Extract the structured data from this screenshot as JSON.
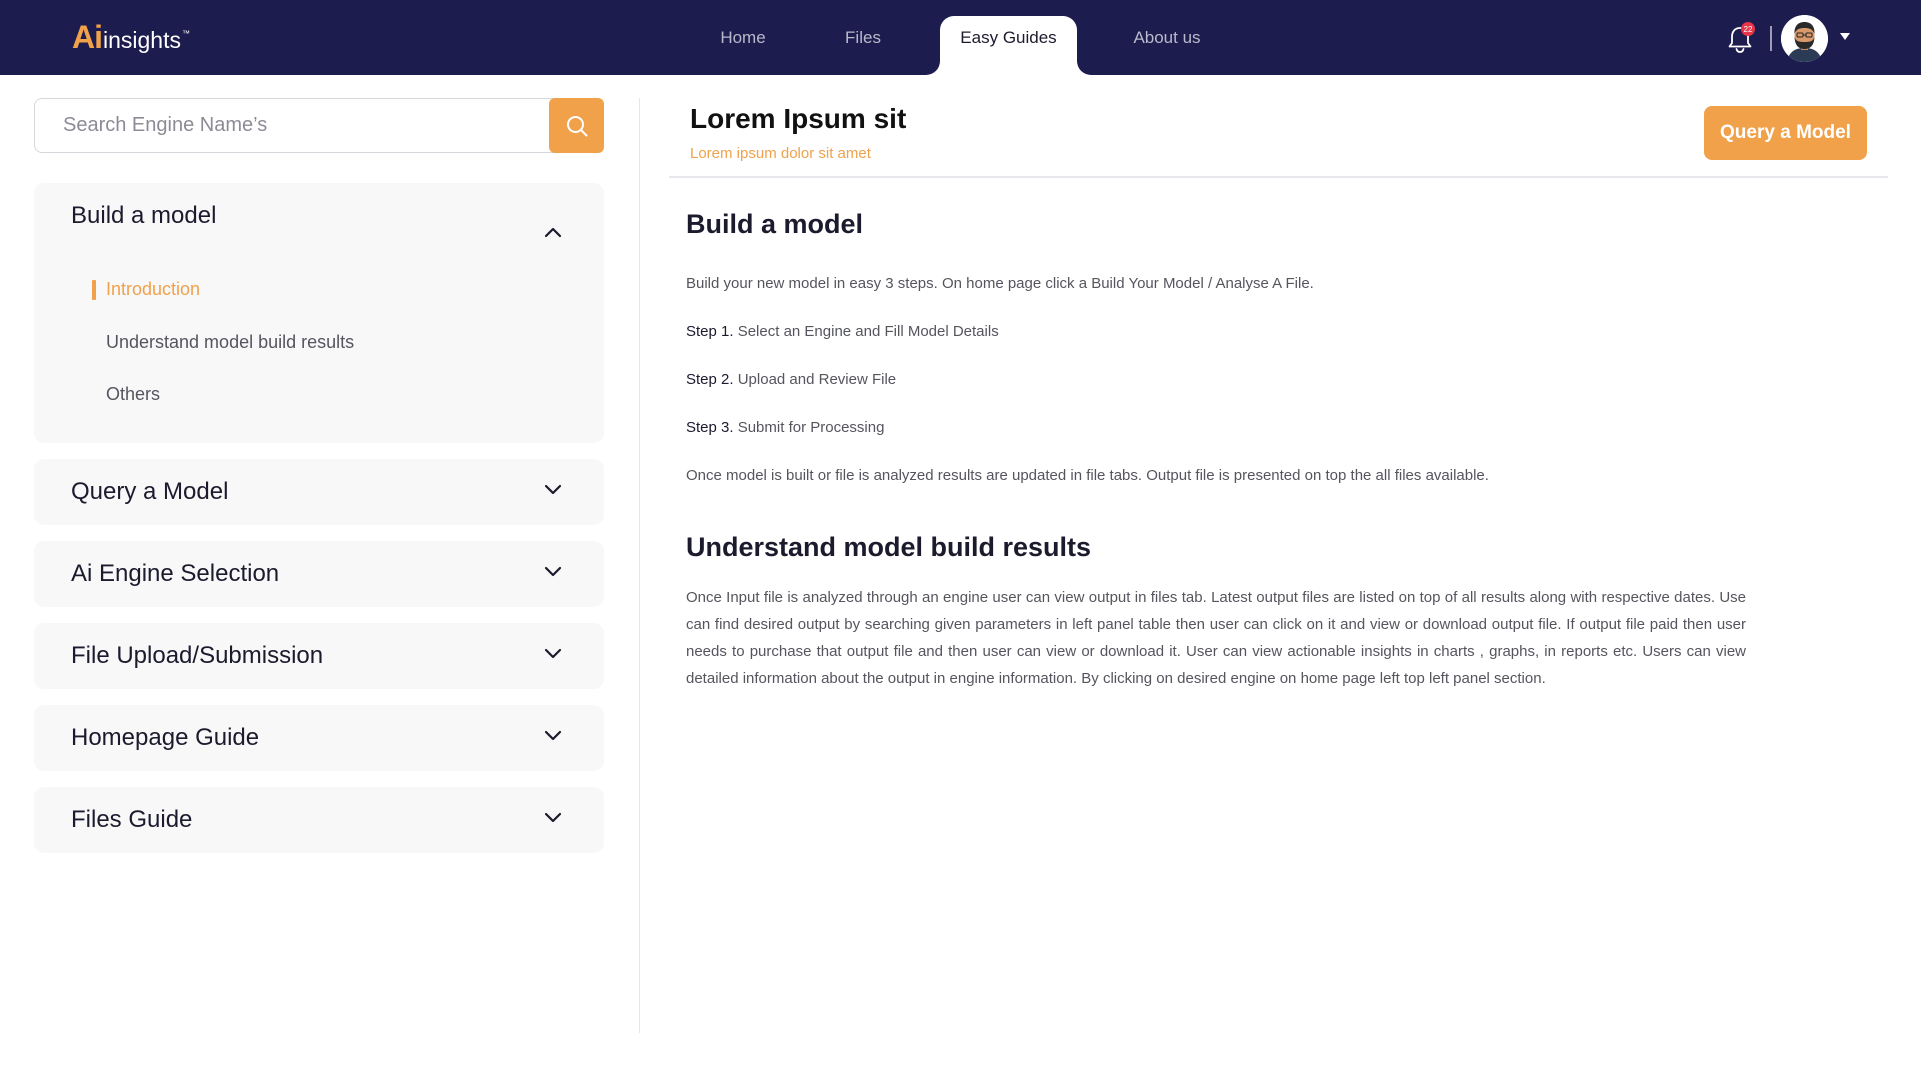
{
  "brand": {
    "logo_ai": "Ai",
    "logo_rest": "insights",
    "logo_tm": "™"
  },
  "nav": {
    "items": [
      {
        "label": "Home"
      },
      {
        "label": "Files"
      },
      {
        "label": "Easy Guides",
        "active": true
      },
      {
        "label": "About us"
      }
    ]
  },
  "header": {
    "notification_count": "22",
    "avatar_icon": "user-avatar",
    "bell_icon": "bell-icon",
    "caret_icon": "caret-down-icon"
  },
  "sidebar": {
    "search": {
      "placeholder": "Search Engine Name’s",
      "value": ""
    },
    "sections": [
      {
        "title": "Build a model",
        "expanded": true,
        "items": [
          {
            "label": "Introduction",
            "active": true
          },
          {
            "label": "Understand model build results"
          },
          {
            "label": "Others"
          }
        ]
      },
      {
        "title": "Query a Model",
        "expanded": false
      },
      {
        "title": "Ai Engine Selection",
        "expanded": false
      },
      {
        "title": "File Upload/Submission",
        "expanded": false
      },
      {
        "title": "Homepage Guide",
        "expanded": false
      },
      {
        "title": "Files Guide",
        "expanded": false
      }
    ]
  },
  "main": {
    "title": "Lorem Ipsum sit",
    "subtitle": "Lorem ipsum dolor sit amet",
    "action_label": "Query a Model",
    "section1": {
      "heading": "Build a model",
      "intro": "Build your new model in easy 3 steps. On home page click a Build Your Model / Analyse A File.",
      "steps": [
        {
          "label": "Step 1.",
          "text": " Select an Engine and Fill Model Details"
        },
        {
          "label": "Step 2.",
          "text": " Upload and Review File"
        },
        {
          "label": "Step 3.",
          "text": " Submit for Processing"
        }
      ],
      "outro": "Once model is built or file is analyzed results are updated in file tabs. Output file is presented on top the all files available."
    },
    "section2": {
      "heading": "Understand model build results",
      "body": "Once Input file is analyzed through an engine user can view output in files tab. Latest output files are listed on top of all results along with respective dates. Use can find desired output by searching given parameters in left panel table then user can click on it and view or download output file. If output file paid then user needs to purchase that output file and then user can view or download it. User can view actionable insights in charts , graphs, in reports etc. Users can view detailed information about the output in engine information. By clicking on desired engine on home page left top left panel section."
    }
  },
  "colors": {
    "topbar": "#1c1c4e",
    "accent": "#f0a14a",
    "badge": "#e8354a"
  }
}
